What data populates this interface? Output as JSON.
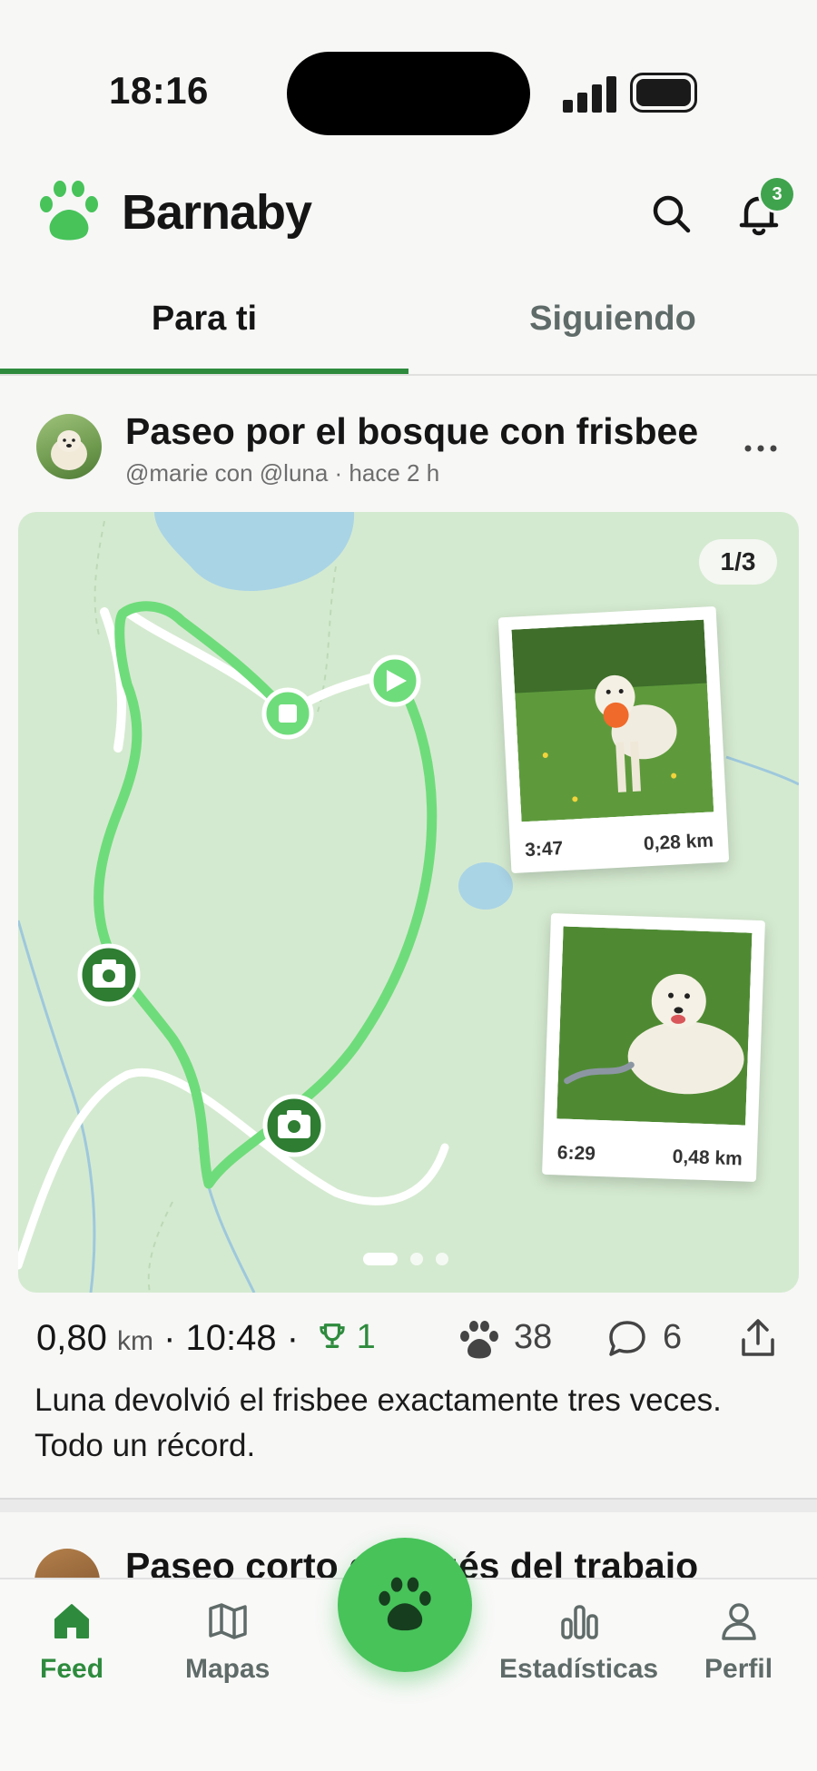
{
  "status_bar": {
    "time": "18:16"
  },
  "header": {
    "brand": "Barnaby",
    "notification_count": "3"
  },
  "tabs": [
    {
      "label": "Para ti",
      "active": true
    },
    {
      "label": "Siguiendo",
      "active": false
    }
  ],
  "post": {
    "title": "Paseo por el bosque con frisbee",
    "meta": "@marie con @luna  ·  hace 2 h",
    "gallery_counter": "1/3",
    "gallery_pages": 3,
    "gallery_active_page": 1,
    "photos": [
      {
        "time": "3:47",
        "distance": "0,28 km"
      },
      {
        "time": "6:29",
        "distance": "0,48 km"
      }
    ],
    "stats": {
      "distance_value": "0,80",
      "distance_unit": "km",
      "duration": "· 10:48 ·",
      "trophies": "1",
      "likes": "38",
      "comments": "6"
    },
    "body": "Luna devolvió el frisbee exactamente tres veces. Todo un récord."
  },
  "next_post": {
    "title": "Paseo corto después del trabajo"
  },
  "nav": {
    "feed": "Feed",
    "maps": "Mapas",
    "stats": "Estadísticas",
    "profile": "Perfil"
  },
  "colors": {
    "accent": "#2e8b3d",
    "route": "#6fdc7b",
    "map_bg": "#d4ead0",
    "fab": "#47c35a"
  }
}
